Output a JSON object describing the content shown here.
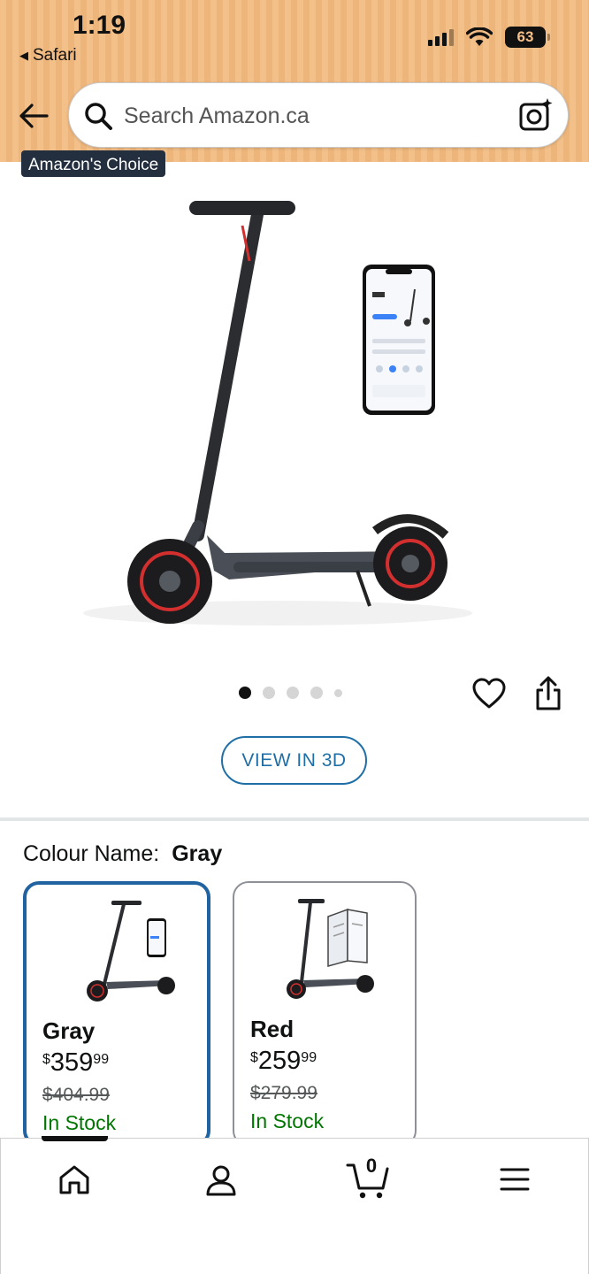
{
  "status_bar": {
    "time": "1:19",
    "back_app": "Safari",
    "battery": "63"
  },
  "search": {
    "placeholder": "Search Amazon.ca"
  },
  "product": {
    "badge": "Amazon's Choice",
    "image_dots": 5,
    "active_dot": 1,
    "view_3d_label": "VIEW IN 3D"
  },
  "colour": {
    "label": "Colour Name:",
    "selected": "Gray"
  },
  "variants": [
    {
      "name": "Gray",
      "currency": "$",
      "price_whole": "359",
      "price_fraction": "99",
      "was_price": "$404.99",
      "availability": "In Stock",
      "selected": true
    },
    {
      "name": "Red",
      "currency": "$",
      "price_whole": "259",
      "price_fraction": "99",
      "was_price": "$279.99",
      "availability": "In Stock",
      "selected": false
    }
  ],
  "bottom_nav": {
    "items": [
      "home-icon",
      "account-icon",
      "cart-icon",
      "menu-icon"
    ],
    "cart_count": "0"
  },
  "colors": {
    "header": "#f3c089",
    "accent_blue": "#1f6fa6",
    "selected_border": "#2162a1",
    "in_stock": "#007600",
    "badge_bg": "#232f3e"
  }
}
